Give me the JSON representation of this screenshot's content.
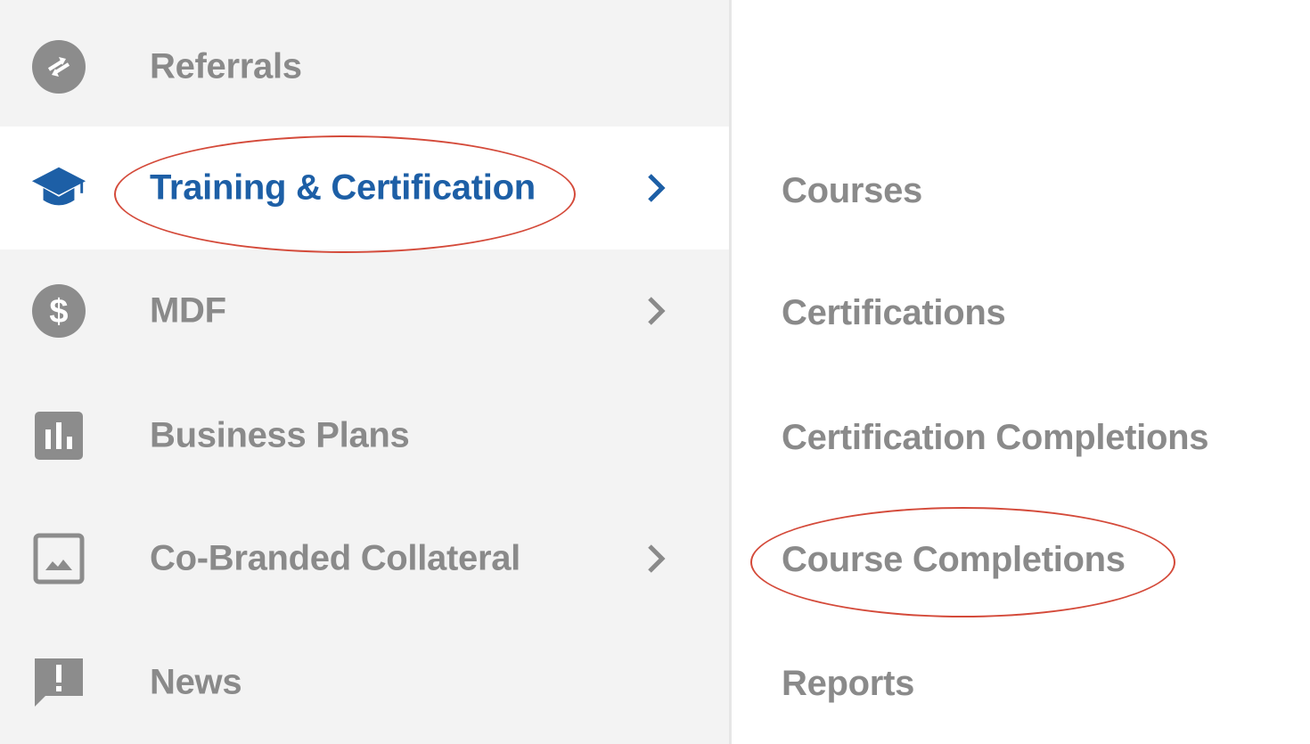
{
  "sidebar": {
    "items": [
      {
        "label": "Referrals",
        "icon": "referrals-icon",
        "has_submenu": false,
        "active": false
      },
      {
        "label": "Training & Certification",
        "icon": "graduation-cap-icon",
        "has_submenu": true,
        "active": true
      },
      {
        "label": "MDF",
        "icon": "dollar-icon",
        "has_submenu": true,
        "active": false
      },
      {
        "label": "Business Plans",
        "icon": "bar-chart-icon",
        "has_submenu": false,
        "active": false
      },
      {
        "label": "Co-Branded Collateral",
        "icon": "image-icon",
        "has_submenu": true,
        "active": false
      },
      {
        "label": "News",
        "icon": "announcement-icon",
        "has_submenu": false,
        "active": false
      }
    ]
  },
  "submenu": {
    "items": [
      {
        "label": "Courses"
      },
      {
        "label": "Certifications"
      },
      {
        "label": "Certification Completions"
      },
      {
        "label": "Course Completions"
      },
      {
        "label": "Reports"
      }
    ]
  },
  "colors": {
    "active_text": "#1d5fa6",
    "inactive_text": "#8a8a8a",
    "icon_gray": "#8c8c8c",
    "sidebar_bg": "#f3f3f3",
    "annotation": "#d44a3a"
  }
}
